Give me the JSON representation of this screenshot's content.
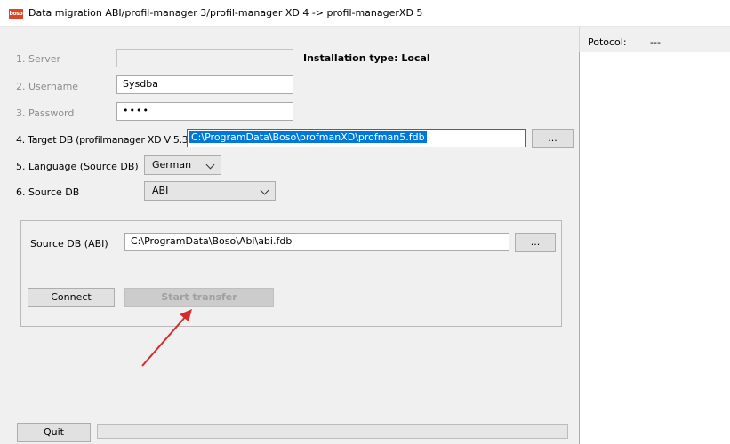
{
  "window": {
    "title": "Data migration ABI/profil-manager 3/profil-manager XD 4 -> profil-managerXD 5",
    "icon_text": "boso"
  },
  "form": {
    "server": {
      "label": "1. Server",
      "value": ""
    },
    "installation_type": "Installation type: Local",
    "username": {
      "label": "2. Username",
      "value": "Sysdba"
    },
    "password": {
      "label": "3. Password",
      "value": "••••"
    },
    "target_db": {
      "label": "4. Target DB (profilmanager XD V 5.3)",
      "value": "C:\\ProgramData\\Boso\\profmanXD\\profman5.fdb",
      "browse_label": "..."
    },
    "language": {
      "label": "5. Language (Source DB)",
      "value": "German"
    },
    "source_db": {
      "label": "6. Source DB",
      "value": "ABI"
    }
  },
  "group": {
    "source_label": "Source DB (ABI)",
    "source_value": "C:\\ProgramData\\Boso\\Abi\\abi.fdb",
    "browse_label": "...",
    "connect_label": "Connect",
    "start_label": "Start transfer"
  },
  "protocol": {
    "label": "Potocol:",
    "value": "---"
  },
  "footer": {
    "quit_label": "Quit",
    "progress": 0
  },
  "colors": {
    "selection": "#0078d7",
    "arrow": "#d62b2b"
  }
}
